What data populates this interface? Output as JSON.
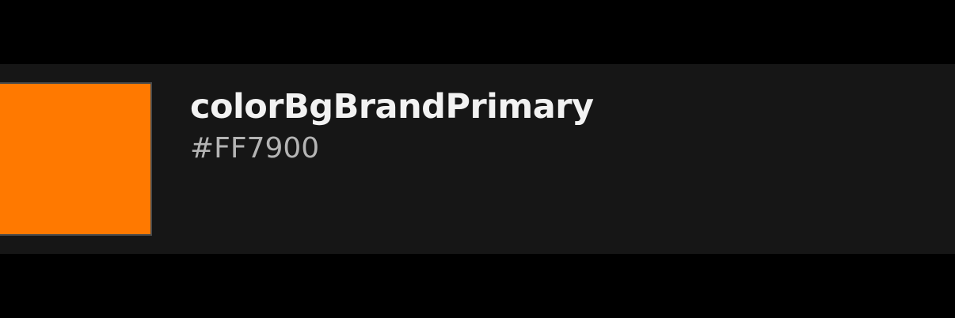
{
  "token": {
    "name": "colorBgBrandPrimary",
    "value": "#FF7900",
    "swatch_color": "#FF7900"
  },
  "colors": {
    "page_background": "#000000",
    "card_background": "#161616",
    "name_text": "#F2F2F2",
    "value_text": "#B4B4B4",
    "swatch_border": "#4A4A4A"
  }
}
